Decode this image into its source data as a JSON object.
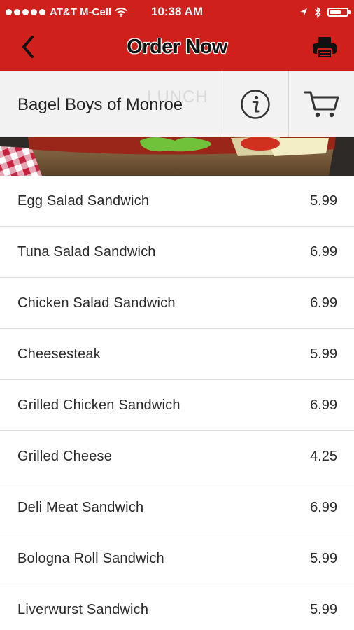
{
  "status_bar": {
    "carrier": "AT&T M-Cell",
    "time": "10:38 AM",
    "icons": [
      "signal-dots-icon",
      "wifi-icon",
      "location-arrow-icon",
      "bluetooth-icon",
      "battery-icon"
    ]
  },
  "nav": {
    "title": "Order Now",
    "back_icon": "chevron-left-icon",
    "print_icon": "printer-icon"
  },
  "restaurant": {
    "name": "Bagel Boys of Monroe",
    "category": "LUNCH",
    "info_icon": "info-circle-icon",
    "cart_icon": "shopping-cart-icon"
  },
  "menu": {
    "items": [
      {
        "name": "Egg Salad Sandwich",
        "price": "5.99"
      },
      {
        "name": "Tuna Salad Sandwich",
        "price": "6.99"
      },
      {
        "name": "Chicken Salad Sandwich",
        "price": "6.99"
      },
      {
        "name": "Cheesesteak",
        "price": "5.99"
      },
      {
        "name": "Grilled Chicken Sandwich",
        "price": "6.99"
      },
      {
        "name": "Grilled Cheese",
        "price": "4.25"
      },
      {
        "name": "Deli Meat Sandwich",
        "price": "6.99"
      },
      {
        "name": "Bologna Roll Sandwich",
        "price": "5.99"
      },
      {
        "name": "Liverwurst Sandwich",
        "price": "5.99"
      }
    ]
  },
  "colors": {
    "brand_red": "#d0201c",
    "text_dark": "#2a2a2a",
    "divider": "#dcdcdc"
  }
}
